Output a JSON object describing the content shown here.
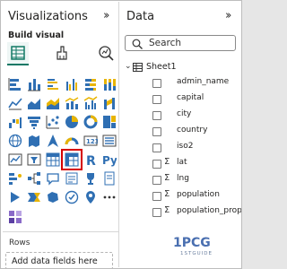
{
  "visualizations": {
    "title": "Visualizations",
    "build_label": "Build visual",
    "rows_label": "Rows",
    "add_fields_placeholder": "Add data fields here"
  },
  "data": {
    "title": "Data",
    "search_placeholder": "Search",
    "table_name": "Sheet1",
    "fields": [
      {
        "name": "admin_name",
        "sigma": false
      },
      {
        "name": "capital",
        "sigma": false
      },
      {
        "name": "city",
        "sigma": false
      },
      {
        "name": "country",
        "sigma": false
      },
      {
        "name": "iso2",
        "sigma": false
      },
      {
        "name": "lat",
        "sigma": true
      },
      {
        "name": "lng",
        "sigma": true
      },
      {
        "name": "population",
        "sigma": true
      },
      {
        "name": "population_proper",
        "sigma": true
      }
    ]
  },
  "icons": {
    "collapse_viz": "chevron-double-right-icon",
    "collapse_data": "chevron-double-right-icon",
    "selected_visual": "matrix-icon"
  },
  "colors": {
    "accent": "#117865",
    "selection": "#d60000",
    "viz_blue": "#2f6fb3",
    "viz_yellow": "#e8b400"
  },
  "logo": {
    "text_top": "1PCG",
    "text_bottom": "1STGUIDE"
  }
}
